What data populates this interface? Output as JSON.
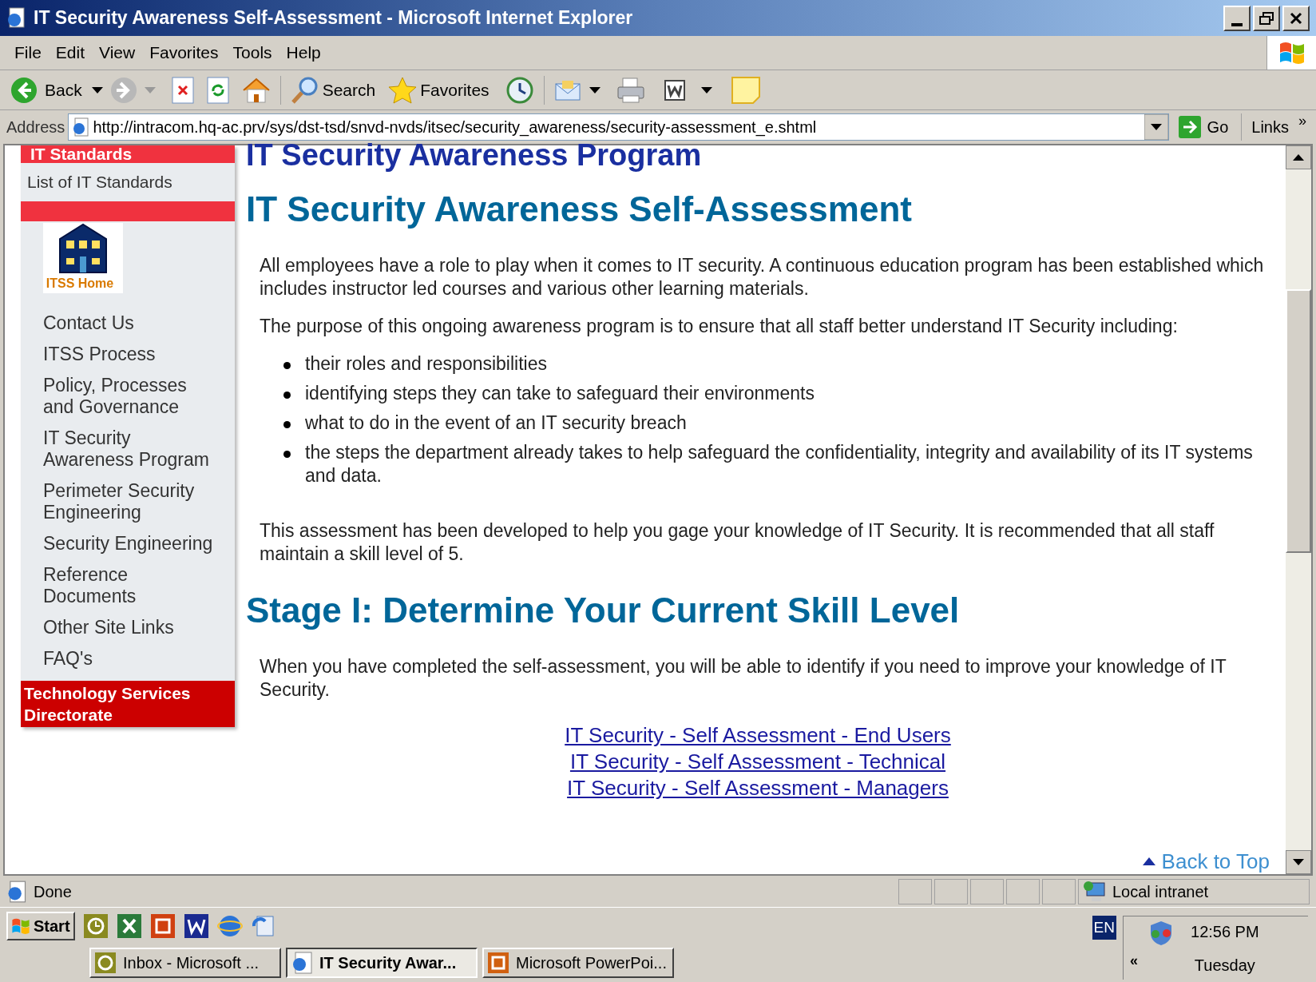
{
  "window": {
    "title": "IT Security Awareness Self-Assessment - Microsoft Internet Explorer"
  },
  "menu": [
    "File",
    "Edit",
    "View",
    "Favorites",
    "Tools",
    "Help"
  ],
  "toolbar": {
    "back_label": "Back",
    "forward_disabled": true,
    "search_label": "Search",
    "favorites_label": "Favorites"
  },
  "address": {
    "label": "Address",
    "url": "http://intracom.hq-ac.prv/sys/dst-tsd/snvd-nvds/itsec/security_awareness/security-assessment_e.shtml",
    "go_label": "Go",
    "links_label": "Links",
    "links_chevron": "»"
  },
  "sidebar": {
    "section_title": "IT Standards",
    "standards_link": "List of IT Standards",
    "home_label": "ITSS Home",
    "items": [
      "Contact Us",
      "ITSS Process",
      "Policy, Processes and Governance",
      "IT Security Awareness Program",
      "Perimeter Security Engineering",
      "Security Engineering",
      "Reference Documents",
      "Other Site Links",
      "FAQ's"
    ],
    "footer": "Technology Services Directorate"
  },
  "content": {
    "program_title": "IT Security Awareness Program",
    "title": "IT Security Awareness Self-Assessment",
    "intro": "All employees have a role to play when it comes to IT security. A continuous education program has been established which includes instructor led courses and various other learning materials.",
    "purpose": "The purpose of this ongoing awareness program is to ensure that all staff better understand IT Security including:",
    "bullets": [
      "their roles and responsibilities",
      "identifying steps they can take to safeguard their environments",
      "what to do in the event of an IT security breach",
      "the steps the department already takes to help safeguard the confidentiality, integrity and availability of its IT systems and data."
    ],
    "assessment": "This assessment has been developed to help you gage your knowledge of IT Security. It is recommended that all staff maintain a skill level of 5.",
    "stage_title": "Stage I: Determine Your Current Skill Level",
    "stage_text": "When you have completed the self-assessment, you will be able to identify if you need to improve your knowledge of IT Security.",
    "links": [
      "IT Security - Self Assessment - End Users",
      "IT Security - Self Assessment - Technical",
      "IT Security - Self Assessment - Managers"
    ],
    "back_to_top": "Back to Top"
  },
  "status_bar": {
    "text": "Done",
    "zone": "Local intranet"
  },
  "taskbar": {
    "start": "Start",
    "language": "EN",
    "tray_chevron": "«",
    "time": "12:56 PM",
    "day": "Tuesday",
    "tasks": [
      {
        "label": "Inbox - Microsoft ...",
        "selected": false
      },
      {
        "label": "IT Security Awar...",
        "selected": true
      },
      {
        "label": "Microsoft PowerPoi...",
        "selected": false
      }
    ]
  }
}
